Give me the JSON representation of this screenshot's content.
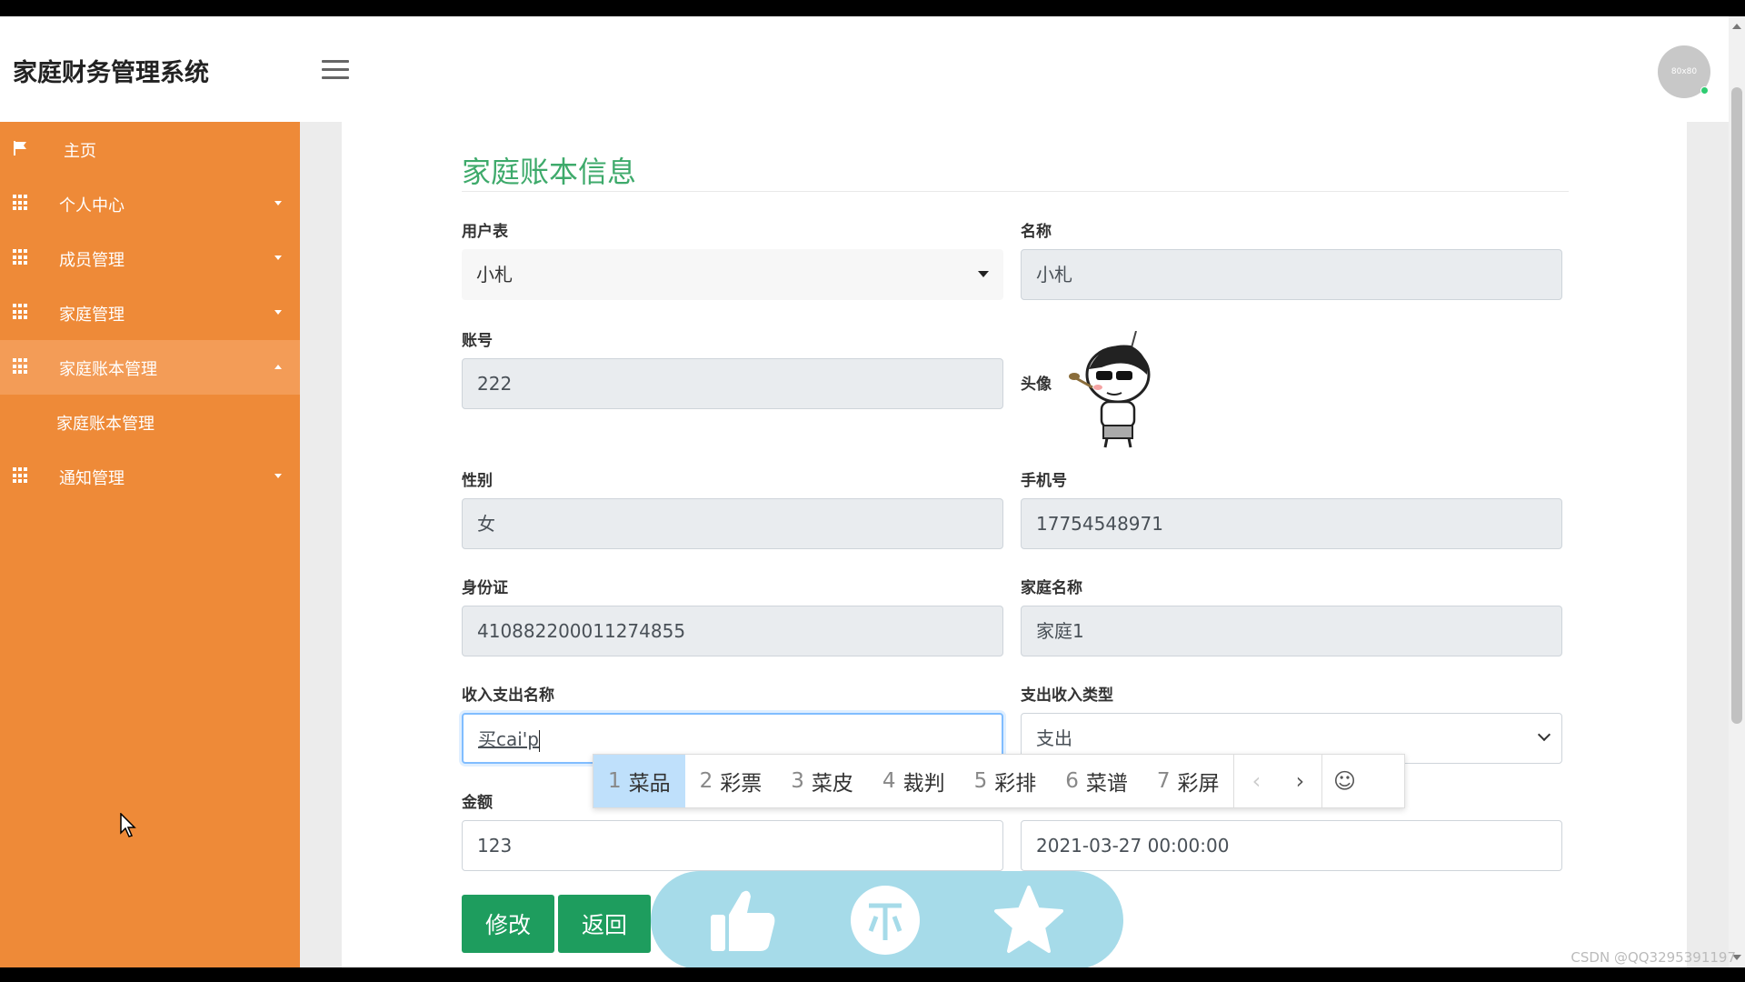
{
  "app": {
    "title": "家庭财务管理系统",
    "avatar_text": "80x80"
  },
  "sidebar": {
    "items": [
      {
        "label": "主页",
        "icon": "flag-icon"
      },
      {
        "label": "个人中心",
        "icon": "grid-icon"
      },
      {
        "label": "成员管理",
        "icon": "grid-icon"
      },
      {
        "label": "家庭管理",
        "icon": "grid-icon"
      },
      {
        "label": "家庭账本管理",
        "icon": "grid-icon",
        "expanded": true
      },
      {
        "label": "通知管理",
        "icon": "grid-icon"
      }
    ],
    "submenu": {
      "label": "家庭账本管理"
    }
  },
  "form": {
    "title": "家庭账本信息",
    "user_table": {
      "label": "用户表",
      "value": "小札"
    },
    "name": {
      "label": "名称",
      "value": "小札"
    },
    "account": {
      "label": "账号",
      "value": "222"
    },
    "avatar": {
      "label": "头像"
    },
    "gender": {
      "label": "性别",
      "value": "女"
    },
    "phone": {
      "label": "手机号",
      "value": "17754548971"
    },
    "id_card": {
      "label": "身份证",
      "value": "410882200011274855"
    },
    "family_name": {
      "label": "家庭名称",
      "value": "家庭1"
    },
    "item_name": {
      "label": "收入支出名称",
      "value": "买cai'p"
    },
    "type": {
      "label": "支出收入类型",
      "value": "支出"
    },
    "amount": {
      "label": "金额",
      "value": "123"
    },
    "time": {
      "value": "2021-03-27 00:00:00"
    },
    "buttons": {
      "edit": "修改",
      "back": "返回"
    }
  },
  "ime": {
    "candidates": [
      {
        "n": "1",
        "text": "菜品"
      },
      {
        "n": "2",
        "text": "彩票"
      },
      {
        "n": "3",
        "text": "菜皮"
      },
      {
        "n": "4",
        "text": "裁判"
      },
      {
        "n": "5",
        "text": "彩排"
      },
      {
        "n": "6",
        "text": "菜谱"
      },
      {
        "n": "7",
        "text": "彩屏"
      }
    ],
    "prev": "‹",
    "next": "›",
    "emoji": "☺"
  },
  "watermark": "CSDN @QQ3295391197",
  "colors": {
    "sidebar": "#ee8a38",
    "accent": "#3eaa6b",
    "button": "#1e9d5e",
    "like_bar": "#a6dbe9"
  }
}
